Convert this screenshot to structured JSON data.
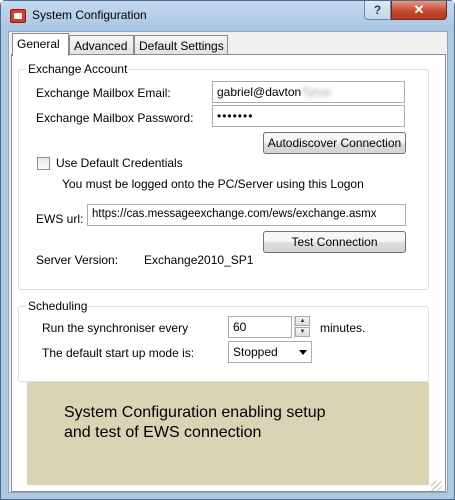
{
  "window": {
    "title": "System Configuration",
    "help_label": "?",
    "close_label": "✕"
  },
  "tabs": [
    {
      "label": "General",
      "active": true
    },
    {
      "label": "Advanced",
      "active": false
    },
    {
      "label": "Default Settings",
      "active": false
    }
  ],
  "exchange_account": {
    "group_title": "Exchange Account",
    "email_label": "Exchange Mailbox Email:",
    "email_value_visible": "gabriel@davton",
    "email_value_blurred": "Tyrus",
    "password_label": "Exchange Mailbox Password:",
    "password_value": "•••••••",
    "autodiscover_label": "Autodiscover Connection",
    "default_credentials_label": "Use Default Credentials",
    "default_credentials_checked": false,
    "default_credentials_note": "You must be logged onto the PC/Server using this Logon",
    "ews_url_label": "EWS url:",
    "ews_url_value": "https://cas.messageexchange.com/ews/exchange.asmx",
    "test_connection_label": "Test Connection",
    "server_version_label": "Server Version:",
    "server_version_value": "Exchange2010_SP1"
  },
  "scheduling": {
    "group_title": "Scheduling",
    "sync_label": "Run the synchroniser every",
    "sync_value": "60",
    "sync_unit": "minutes.",
    "startup_label": "The default start up mode is:",
    "startup_value": "Stopped"
  },
  "caption": {
    "line1": "System Configuration enabling setup",
    "line2": "and test of EWS connection"
  }
}
